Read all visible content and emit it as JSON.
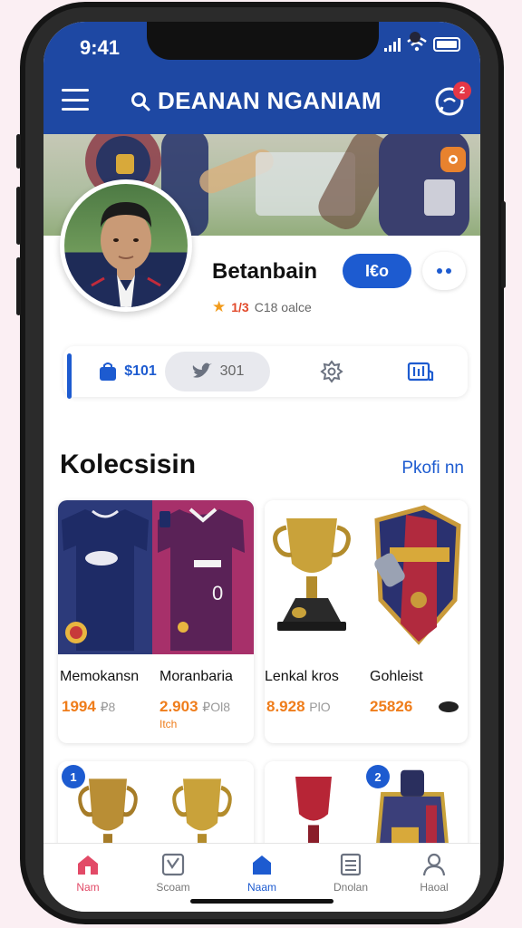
{
  "status_bar": {
    "time": "9:41"
  },
  "header": {
    "title": "DEANAN NGANIAM",
    "notification_count": "2"
  },
  "profile": {
    "name": "Betanbain",
    "follow_label": "I€o",
    "rating_value": "1/3",
    "rating_text": "C18 oalce"
  },
  "stats": [
    {
      "icon": "shopping-bag-icon",
      "value": "$101"
    },
    {
      "icon": "twitter-bird-icon",
      "value": "301"
    },
    {
      "icon": "gear-icon",
      "value": ""
    },
    {
      "icon": "chart-icon",
      "value": ""
    }
  ],
  "collection": {
    "title": "Kolecsisin",
    "link": "Pkofi nn",
    "items": [
      {
        "label": "Memokansn",
        "price": "1994",
        "price_suffix": "₽8"
      },
      {
        "label": "Moranbaria",
        "price": "2.903",
        "price_suffix": "₽Ol8",
        "extra": "Itch"
      },
      {
        "label": "Lenkal kros",
        "price": "8.928",
        "price_suffix": "PlO"
      },
      {
        "label": "Gohleist",
        "price": "25826",
        "price_suffix": ""
      }
    ],
    "row2_badges": [
      "1",
      "2"
    ]
  },
  "nav": [
    {
      "label": "Nam",
      "icon": "home-icon"
    },
    {
      "label": "Scoam",
      "icon": "chart-icon"
    },
    {
      "label": "Naam",
      "icon": "store-icon"
    },
    {
      "label": "Dnolan",
      "icon": "list-icon"
    },
    {
      "label": "Haoal",
      "icon": "user-icon"
    }
  ],
  "colors": {
    "header": "#1e48a3",
    "accent": "#1d5bd0",
    "price": "#ef7d1b",
    "home_nav": "#e24a67"
  }
}
